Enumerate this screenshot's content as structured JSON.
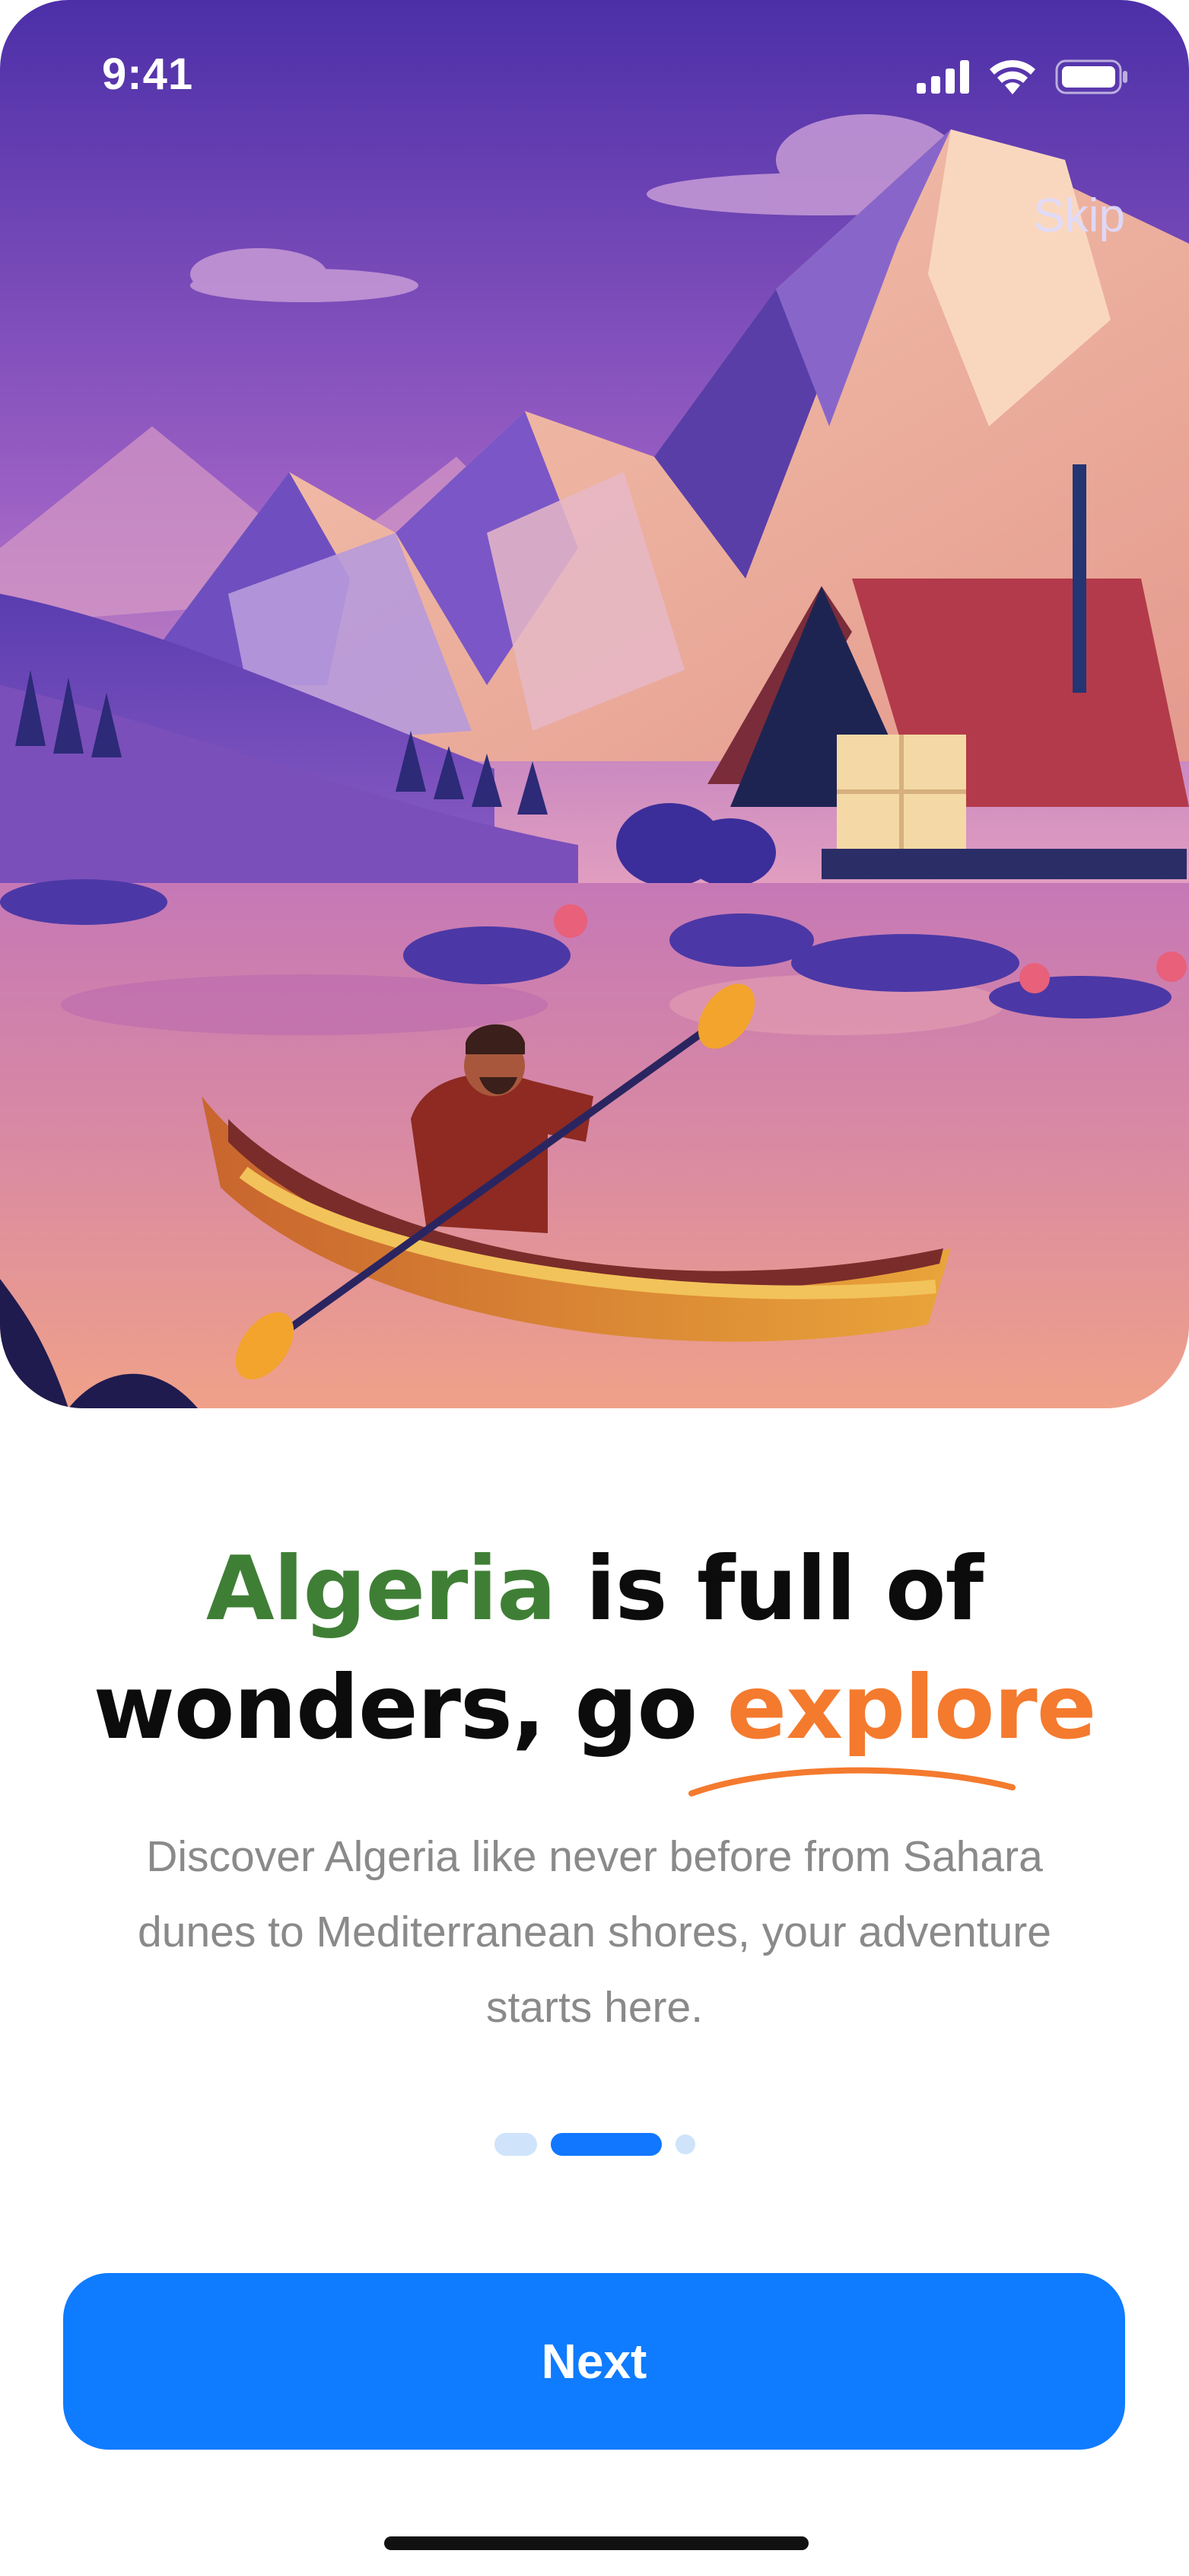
{
  "status_bar": {
    "time": "9:41",
    "icons": [
      "cellular-signal-icon",
      "wifi-icon",
      "battery-icon"
    ]
  },
  "header": {
    "skip_label": "Skip"
  },
  "hero": {
    "illustration": "kayaker-lake-cabin-mountains-illustration"
  },
  "onboarding": {
    "headline": {
      "part1": "Algeria",
      "part2": " is full of",
      "part3": "wonders, go ",
      "part4": "explore"
    },
    "description": "Discover Algeria like never before from Sahara dunes to Mediterranean shores, your adventure starts here.",
    "pager": {
      "total": 3,
      "active_index": 1
    }
  },
  "actions": {
    "next_label": "Next"
  },
  "colors": {
    "accent_blue": "#0f7bff",
    "headline_green": "#3f7f35",
    "headline_orange": "#f47a2e",
    "body_text": "#8a8a8a",
    "pager_inactive": "#cfe3fb"
  }
}
